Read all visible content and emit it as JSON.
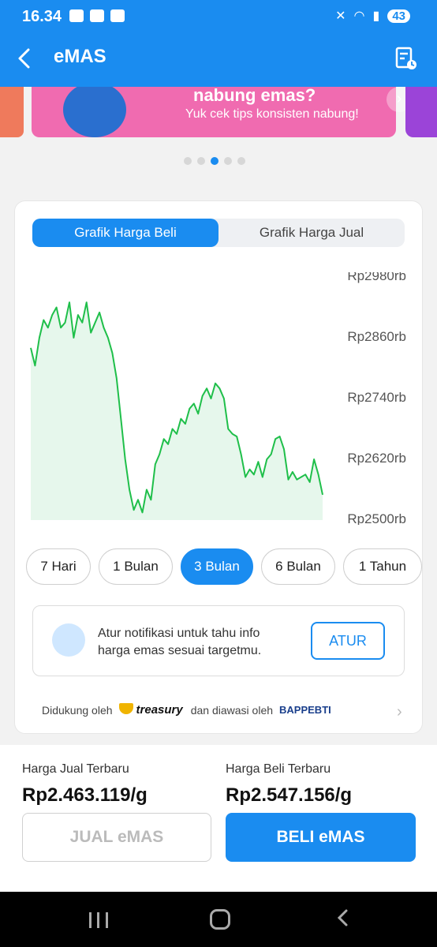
{
  "status_bar": {
    "time": "16.34",
    "battery": "43"
  },
  "app_bar": {
    "title": "eMAS"
  },
  "banner": {
    "title": "nabung emas?",
    "subtitle": "Yuk cek tips konsisten nabung!"
  },
  "tabs": [
    {
      "label": "Grafik Harga Beli",
      "active": true
    },
    {
      "label": "Grafik Harga Jual",
      "active": false
    }
  ],
  "chart_data": {
    "type": "area",
    "y_tick_labels": [
      "Rp2980rb",
      "Rp2860rb",
      "Rp2740rb",
      "Rp2620rb",
      "Rp2500rb"
    ],
    "ylim": [
      2500,
      2980
    ],
    "y_unit": "rb",
    "series": [
      {
        "values": [
          2840,
          2805,
          2860,
          2895,
          2880,
          2905,
          2920,
          2880,
          2890,
          2930,
          2860,
          2905,
          2890,
          2930,
          2870,
          2890,
          2910,
          2880,
          2860,
          2830,
          2780,
          2700,
          2620,
          2560,
          2520,
          2540,
          2515,
          2560,
          2540,
          2610,
          2630,
          2660,
          2650,
          2680,
          2670,
          2700,
          2690,
          2720,
          2730,
          2710,
          2745,
          2760,
          2740,
          2770,
          2760,
          2740,
          2680,
          2670,
          2665,
          2630,
          2585,
          2600,
          2590,
          2615,
          2585,
          2620,
          2630,
          2660,
          2665,
          2640,
          2580,
          2595,
          2580,
          2585,
          2590,
          2575,
          2620,
          2590,
          2550
        ]
      }
    ],
    "line_color": "#1fbf4a",
    "fill_color": "#e6f7ec"
  },
  "ranges": [
    {
      "label": "7 Hari",
      "active": false
    },
    {
      "label": "1 Bulan",
      "active": false
    },
    {
      "label": "3 Bulan",
      "active": true
    },
    {
      "label": "6 Bulan",
      "active": false
    },
    {
      "label": "1 Tahun",
      "active": false
    }
  ],
  "notification": {
    "text": "Atur notifikasi untuk tahu info harga emas sesuai targetmu.",
    "button": "ATUR"
  },
  "footer": {
    "supported_by": "Didukung oleh",
    "partner": "treasury",
    "supervised_by": "dan diawasi oleh",
    "regulator": "BAPPEBTI"
  },
  "prices": {
    "sell_label": "Harga Jual Terbaru",
    "sell_value": "Rp2.463.119/g",
    "buy_label": "Harga Beli Terbaru",
    "buy_value": "Rp2.547.156/g"
  },
  "actions": {
    "sell": "JUAL eMAS",
    "buy": "BELI eMAS"
  },
  "colors": {
    "primary": "#1a8cf0",
    "chart_line": "#1fbf4a"
  }
}
